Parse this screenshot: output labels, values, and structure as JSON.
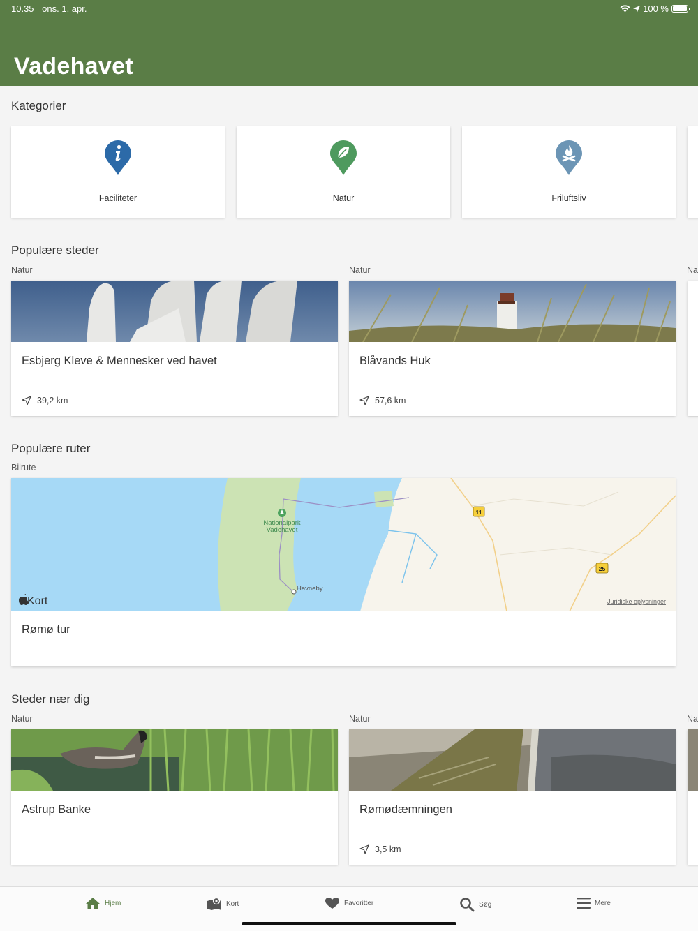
{
  "status_bar": {
    "time": "10.35",
    "date": "ons. 1. apr.",
    "battery": "100 %"
  },
  "header": {
    "title": "Vadehavet"
  },
  "categories": {
    "title": "Kategorier",
    "items": [
      {
        "label": "Faciliteter",
        "icon": "info-pin-icon",
        "color": "#2c6aa8"
      },
      {
        "label": "Natur",
        "icon": "leaf-pin-icon",
        "color": "#4e9a5e"
      },
      {
        "label": "Friluftsliv",
        "icon": "campfire-pin-icon",
        "color": "#6c95b5"
      }
    ]
  },
  "popular_places": {
    "title": "Populære steder",
    "items": [
      {
        "category": "Natur",
        "name": "Esbjerg Kleve & Mennesker ved havet",
        "distance": "39,2 km"
      },
      {
        "category": "Natur",
        "name": "Blåvands Huk",
        "distance": "57,6 km"
      },
      {
        "category": "Na"
      }
    ]
  },
  "popular_routes": {
    "title": "Populære ruter",
    "items": [
      {
        "category": "Bilrute",
        "name": "Rømø tur",
        "map": {
          "brand": "Kort",
          "poi_line1": "Nationalpark",
          "poi_line2": "Vadehavet",
          "town": "Havneby",
          "road_11": "11",
          "road_25": "25",
          "legal": "Juridiske oplysninger"
        }
      }
    ]
  },
  "nearby_places": {
    "title": "Steder nær dig",
    "items": [
      {
        "category": "Natur",
        "name": "Astrup Banke"
      },
      {
        "category": "Natur",
        "name": "Rømødæmningen",
        "distance": "3,5 km"
      },
      {
        "category": "Na"
      }
    ]
  },
  "tabbar": {
    "items": [
      {
        "label": "Hjem",
        "icon": "home-icon",
        "active": true
      },
      {
        "label": "Kort",
        "icon": "map-icon"
      },
      {
        "label": "Favoritter",
        "icon": "heart-icon"
      },
      {
        "label": "Søg",
        "icon": "search-icon"
      },
      {
        "label": "Mere",
        "icon": "menu-icon"
      }
    ]
  },
  "colors": {
    "brand_green": "#5a7d46",
    "sea": "#a6d9f6",
    "land": "#f7f4ec",
    "island": "#cce3b4"
  }
}
